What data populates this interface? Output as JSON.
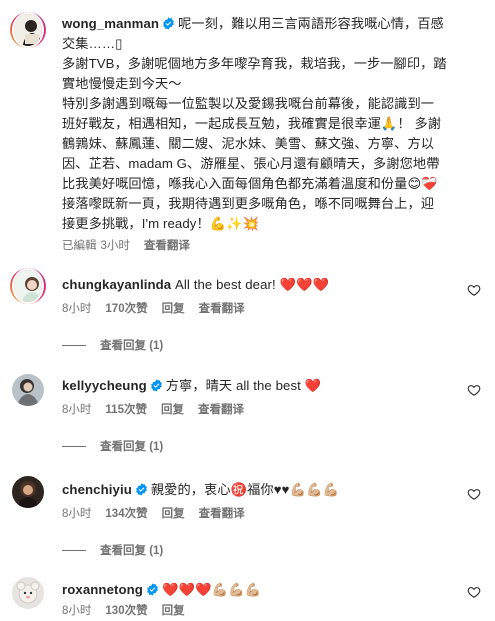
{
  "caption": {
    "username": "wong_manman",
    "lines": [
      "呢一刻，難以用三言兩語形容我嘅心情，百感",
      "交集……▯",
      "多謝TVB，多謝呢個地方多年嚟孕育我，栽培我，一步一腳印，踏",
      "實地慢慢走到今天～",
      "特別多謝遇到嘅每一位監製以及愛錫我嘅台前幕後，能認識到一",
      "班好戰友，相遇相知，一起成長互勉，我確實是很幸運🙏！ 多謝",
      "鶴鶉妹、蘇鳳蓮、關二嫂、泥水妹、美雪、蘇文強、方寧、方以",
      "因、芷若、madam G、游雁星、張心月還有顧晴天，多謝您地帶",
      "比我美好嘅回憶，喺我心入面每個角色都充滿着溫度和份量😊❤️‍🩹",
      "接落嚟既新一頁，我期待遇到更多嘅角色，喺不同嘅舞台上，迎",
      "接更多挑戰，I'm ready！💪✨💥"
    ],
    "edited": "已編輯",
    "time": "3小时",
    "translate": "查看翻译"
  },
  "comments": [
    {
      "username": "chungkayanlinda",
      "verified": false,
      "text": "All the best dear! ❤️❤️❤️",
      "time": "8小时",
      "likes": "170次赞",
      "reply": "回复",
      "translate": "查看翻译",
      "view_replies": "查看回复 (1)"
    },
    {
      "username": "kellyycheung",
      "verified": true,
      "text": "方寧，晴天 all the best ❤️",
      "time": "8小时",
      "likes": "115次赞",
      "reply": "回复",
      "translate": "查看翻译",
      "view_replies": "查看回复 (1)"
    },
    {
      "username": "chenchiyiu",
      "verified": true,
      "text": "親愛的，衷心㊗️福你♥♥💪🏼💪🏼💪🏼",
      "time": "8小时",
      "likes": "134次赞",
      "reply": "回复",
      "translate": "查看翻译",
      "view_replies": "查看回复 (1)"
    },
    {
      "username": "roxannetong",
      "verified": true,
      "text": "❤️❤️❤️💪🏼💪🏼💪🏼",
      "time": "8小时",
      "likes": "130次赞",
      "reply": "回复"
    }
  ]
}
